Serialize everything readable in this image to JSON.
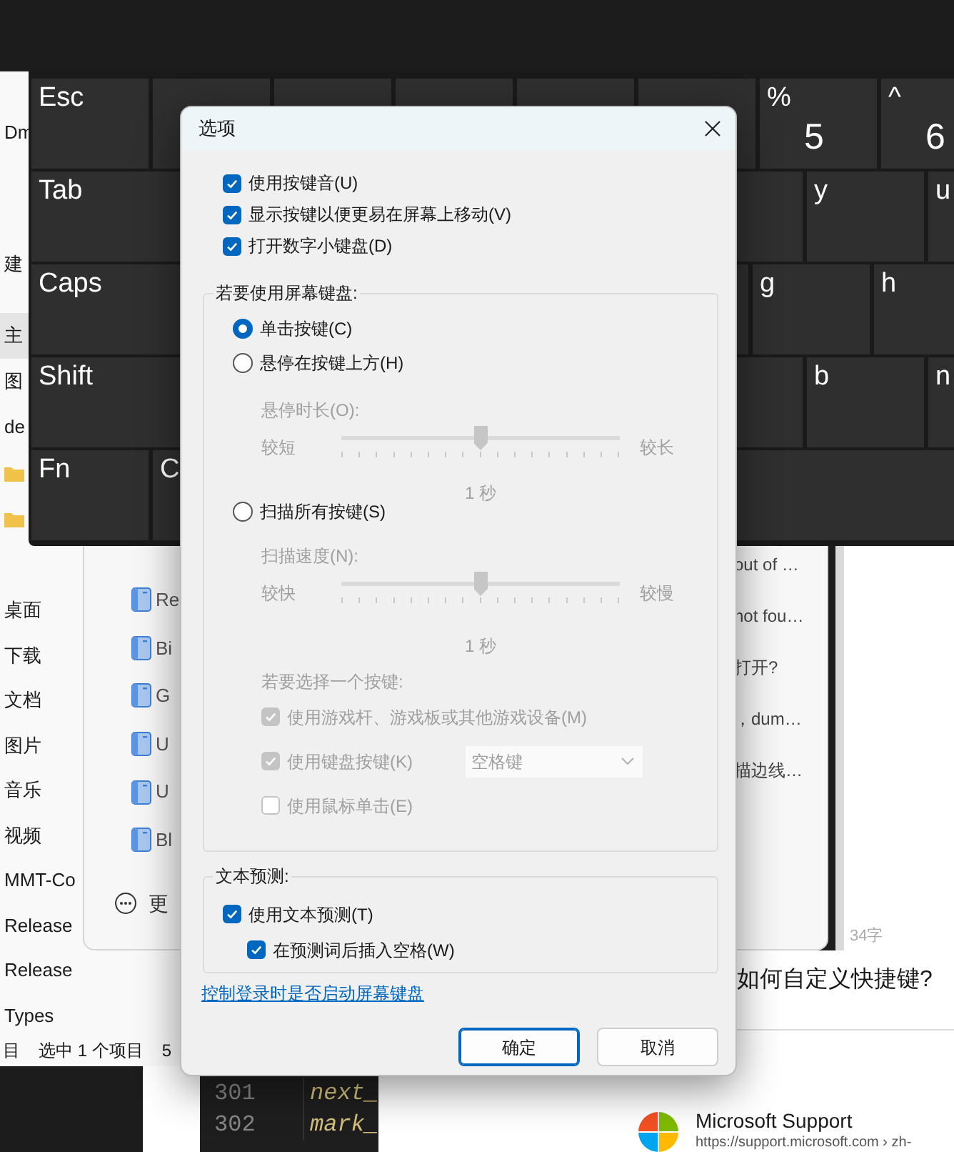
{
  "keyboard": {
    "rows": [
      [
        {
          "kind": "key",
          "label": "Esc"
        },
        {
          "kind": "blank"
        },
        {
          "kind": "blank"
        },
        {
          "kind": "blank"
        },
        {
          "kind": "blank"
        },
        {
          "kind": "blank"
        },
        {
          "kind": "key",
          "label": "%",
          "sub": "5"
        },
        {
          "kind": "key",
          "label": "^",
          "sub": "6"
        }
      ],
      [
        {
          "kind": "key",
          "label": "Tab"
        },
        {
          "kind": "blank"
        },
        {
          "kind": "blank"
        },
        {
          "kind": "blank"
        },
        {
          "kind": "blank"
        },
        {
          "kind": "blank"
        },
        {
          "kind": "key",
          "label": "y"
        },
        {
          "kind": "key",
          "label": "u"
        }
      ],
      [
        {
          "kind": "key",
          "label": "Caps"
        },
        {
          "kind": "blank"
        },
        {
          "kind": "blank"
        },
        {
          "kind": "blank"
        },
        {
          "kind": "blank"
        },
        {
          "kind": "key",
          "label": "g"
        },
        {
          "kind": "key",
          "label": "h"
        }
      ],
      [
        {
          "kind": "key",
          "label": "Shift"
        },
        {
          "kind": "blank"
        },
        {
          "kind": "blank"
        },
        {
          "kind": "blank"
        },
        {
          "kind": "blank"
        },
        {
          "kind": "key",
          "label": "b"
        },
        {
          "kind": "key",
          "label": "n"
        }
      ],
      [
        {
          "kind": "key",
          "label": "Fn"
        },
        {
          "kind": "key",
          "label": "C"
        },
        {
          "kind": "blank"
        },
        {
          "kind": "blank"
        }
      ]
    ]
  },
  "explorer": {
    "nav_top": [
      {
        "kind": "text",
        "text": "Dm",
        "selected": false
      },
      {
        "kind": "text",
        "text": "建",
        "selected": false
      },
      {
        "kind": "text",
        "text": "主",
        "selected": true
      },
      {
        "kind": "text",
        "text": "图",
        "selected": false
      },
      {
        "kind": "text",
        "text": "de",
        "selected": false
      },
      {
        "kind": "folder"
      },
      {
        "kind": "folder"
      }
    ],
    "nav_items": [
      "桌面",
      "下载",
      "文档",
      "图片",
      "音乐",
      "视频",
      "MMT-Co",
      "Release",
      "Release",
      "Types"
    ],
    "status": [
      "目",
      "选中 1 个项目",
      "5"
    ]
  },
  "popup": {
    "files": [
      "Re",
      "Bi",
      "G",
      "U",
      "U",
      "Bl"
    ],
    "more": "更",
    "results": [
      "out of …",
      "not fou…",
      "打开?",
      "，dum…",
      "描边线…"
    ],
    "word_count": "34字"
  },
  "web": {
    "heading": "如何自定义快捷键?",
    "source": {
      "name": "Microsoft Support",
      "url": "https://support.microsoft.com › zh-"
    }
  },
  "editor": {
    "lines": [
      {
        "number": "301",
        "code": "next_"
      },
      {
        "number": "302",
        "code": "mark_"
      }
    ]
  },
  "dialog": {
    "title": "选项",
    "options": [
      {
        "label": "使用按键音(U)",
        "checked": true
      },
      {
        "label": "显示按键以便更易在屏幕上移动(V)",
        "checked": true
      },
      {
        "label": "打开数字小键盘(D)",
        "checked": true
      }
    ],
    "mode_legend": "若要使用屏幕键盘:",
    "modes": [
      {
        "label": "单击按键(C)",
        "selected": true
      },
      {
        "label": "悬停在按键上方(H)",
        "selected": false,
        "slider": {
          "label": "悬停时长(O):",
          "min_label": "较短",
          "max_label": "较长",
          "level": 0.5,
          "reading": "1 秒"
        }
      },
      {
        "label": "扫描所有按键(S)",
        "selected": false,
        "slider": {
          "label": "扫描速度(N):",
          "min_label": "较快",
          "max_label": "较慢",
          "level": 0.5,
          "reading": "1 秒"
        },
        "choose_label": "若要选择一个按键:",
        "choices": [
          {
            "label": "使用游戏杆、游戏板或其他游戏设备(M)",
            "checked": true
          },
          {
            "label": "使用键盘按键(K)",
            "checked": true,
            "dropdown": "空格键"
          },
          {
            "label": "使用鼠标单击(E)",
            "checked": false
          }
        ]
      }
    ],
    "prediction": {
      "legend": "文本预测:",
      "options": [
        {
          "label": "使用文本预测(T)",
          "checked": true,
          "children": [
            {
              "label": "在预测词后插入空格(W)",
              "checked": true
            }
          ]
        }
      ]
    },
    "link": "控制登录时是否启动屏幕键盘",
    "buttons": [
      {
        "label": "确定",
        "default": true
      },
      {
        "label": "取消",
        "default": false
      }
    ]
  }
}
